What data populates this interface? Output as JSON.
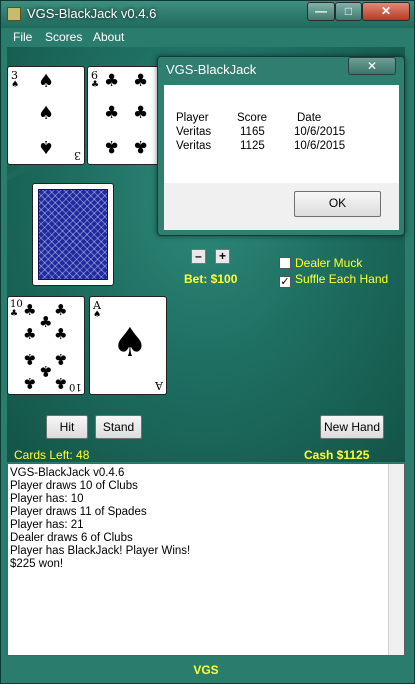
{
  "window": {
    "title": "VGS-BlackJack v0.4.6"
  },
  "title_controls": {
    "minimize": "—",
    "maximize": "□",
    "close": "✕"
  },
  "menu": {
    "items": [
      "File",
      "Scores",
      "About"
    ]
  },
  "dealer_cards": [
    {
      "rank": "3",
      "suit": "spades",
      "symbol": "♠"
    },
    {
      "rank": "6",
      "suit": "clubs",
      "symbol": "♣"
    }
  ],
  "player_cards": [
    {
      "rank": "10",
      "suit": "clubs",
      "symbol": "♣"
    },
    {
      "rank": "A",
      "suit": "spades",
      "symbol": "♠"
    }
  ],
  "bet": {
    "minus": "–",
    "plus": "+",
    "label": "Bet: $100"
  },
  "options": {
    "dealer_muck": {
      "label": "Dealer Muck",
      "checked": false
    },
    "shuffle": {
      "label": "Suffle Each Hand",
      "checked": true
    }
  },
  "buttons": {
    "hit": "Hit",
    "stand": "Stand",
    "new_hand": "New Hand"
  },
  "status": {
    "cards_left": "Cards Left: 48",
    "cash": "Cash $1125"
  },
  "log": [
    "VGS-BlackJack v0.4.6",
    "Player draws 10 of Clubs",
    "Player has: 10",
    "Player draws 11 of Spades",
    "Player has: 21",
    "Dealer draws 6 of Clubs",
    "Player has BlackJack! Player Wins!",
    "$225 won!"
  ],
  "footer": "VGS",
  "dialog": {
    "title": "VGS-BlackJack",
    "close": "✕",
    "headers": {
      "player": "Player",
      "score": "Score",
      "date": "Date"
    },
    "rows": [
      {
        "player": "Veritas",
        "score": "1165",
        "date": "10/6/2015"
      },
      {
        "player": "Veritas",
        "score": "1125",
        "date": "10/6/2015"
      }
    ],
    "ok": "OK"
  },
  "colors": {
    "felt": "#1e6f62",
    "accent_text": "#ffff33",
    "card_back": "#1f2aa0"
  }
}
